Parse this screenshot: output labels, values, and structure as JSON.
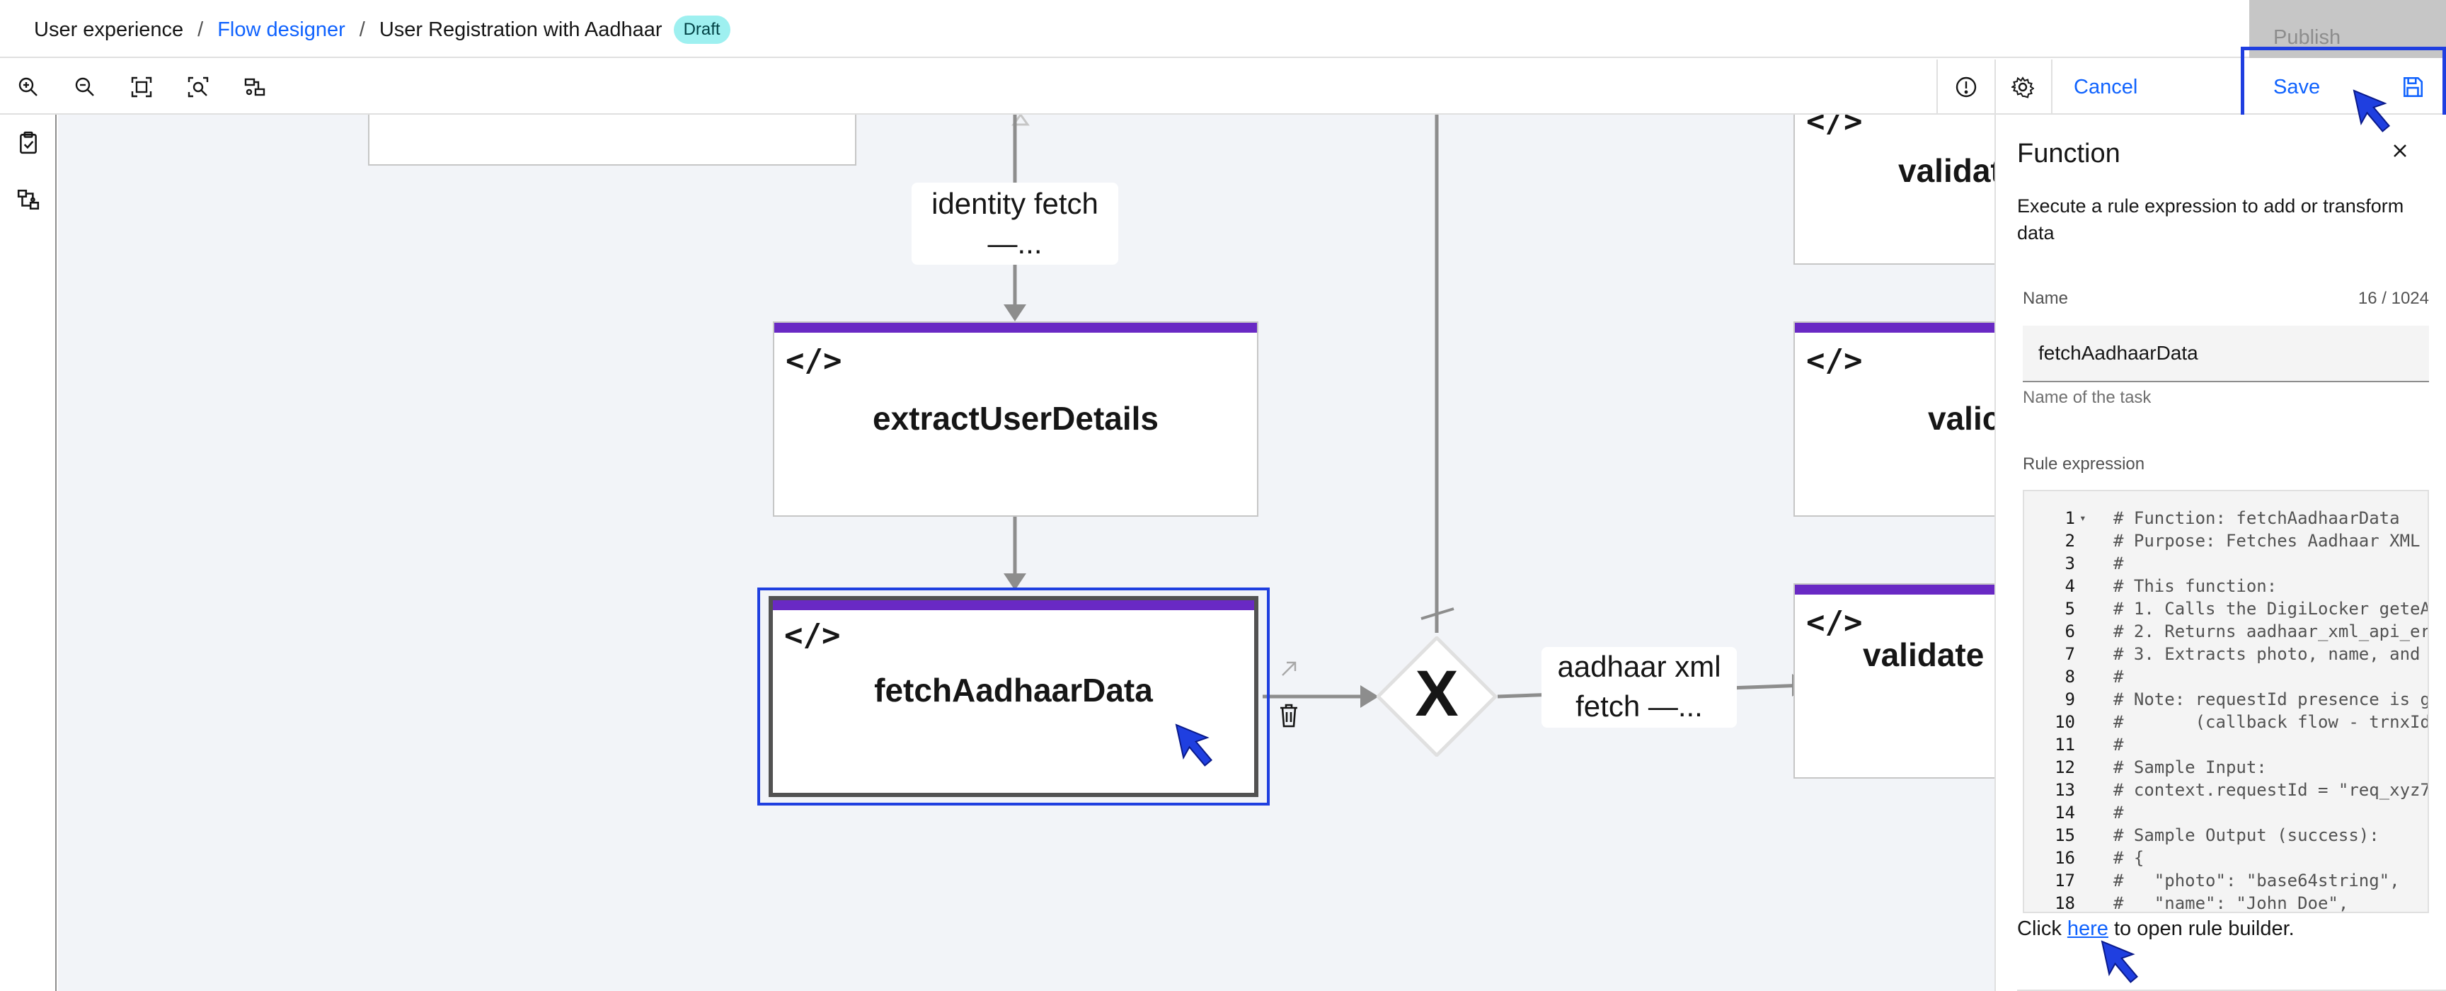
{
  "header": {
    "breadcrumbs": [
      "User experience",
      "Flow designer"
    ],
    "current": "User Registration with Aadhaar",
    "badge": "Draft",
    "publish_label": "Publish"
  },
  "toolbar": {
    "tools": [
      "zoom-in-icon",
      "zoom-out-icon",
      "fit-to-screen-icon",
      "zoom-to-selection-icon",
      "auto-layout-icon"
    ],
    "cancel_label": "Cancel",
    "save_label": "Save"
  },
  "left_rail": {
    "items": [
      "task-list-icon",
      "flow-map-icon"
    ]
  },
  "canvas": {
    "nodes": {
      "extract": {
        "name": "extractUserDetails",
        "icon": "</>"
      },
      "fetch": {
        "name": "fetchAadhaarData",
        "icon": "</>"
      },
      "validate_right_top": {
        "name": "validat",
        "icon": "</>"
      },
      "validate_right_mid": {
        "name": "valic",
        "icon": "</>"
      },
      "validate_right_bottom": {
        "name": "validate",
        "icon": "</>"
      }
    },
    "edges": {
      "identity_fetch": [
        "identity fetch",
        "—..."
      ],
      "aadhaar_xml_fetch": [
        "aadhaar xml",
        "fetch —..."
      ]
    },
    "gateway_symbol": "X",
    "colors": {
      "node_accent": "#6929c4",
      "selection": "#1f3fe0",
      "connector": "#8d8d8d"
    }
  },
  "panel": {
    "title": "Function",
    "description": "Execute a rule expression to add or transform data",
    "name_label": "Name",
    "name_count": "16 / 1024",
    "name_value": "fetchAadhaarData",
    "name_helper": "Name of the task",
    "rule_label": "Rule expression",
    "code_lines": [
      {
        "n": "1",
        "t": "# Function: fetchAadhaarData"
      },
      {
        "n": "2",
        "t": "# Purpose: Fetches Aadhaar XML"
      },
      {
        "n": "3",
        "t": "#"
      },
      {
        "n": "4",
        "t": "# This function:"
      },
      {
        "n": "5",
        "t": "# 1. Calls the DigiLocker geteA"
      },
      {
        "n": "6",
        "t": "# 2. Returns aadhaar_xml_api_er"
      },
      {
        "n": "7",
        "t": "# 3. Extracts photo, name, and"
      },
      {
        "n": "8",
        "t": "#"
      },
      {
        "n": "9",
        "t": "# Note: requestId presence is g"
      },
      {
        "n": "10",
        "t": "#       (callback flow - trnxId"
      },
      {
        "n": "11",
        "t": "#"
      },
      {
        "n": "12",
        "t": "# Sample Input:"
      },
      {
        "n": "13",
        "t": "# context.requestId = \"req_xyz7"
      },
      {
        "n": "14",
        "t": "#"
      },
      {
        "n": "15",
        "t": "# Sample Output (success):"
      },
      {
        "n": "16",
        "t": "# {"
      },
      {
        "n": "17",
        "t": "#   \"photo\": \"base64string\","
      },
      {
        "n": "18",
        "t": "#   \"name\": \"John Doe\","
      }
    ],
    "footer_prefix": "Click ",
    "footer_link": "here",
    "footer_suffix": " to open rule builder."
  }
}
